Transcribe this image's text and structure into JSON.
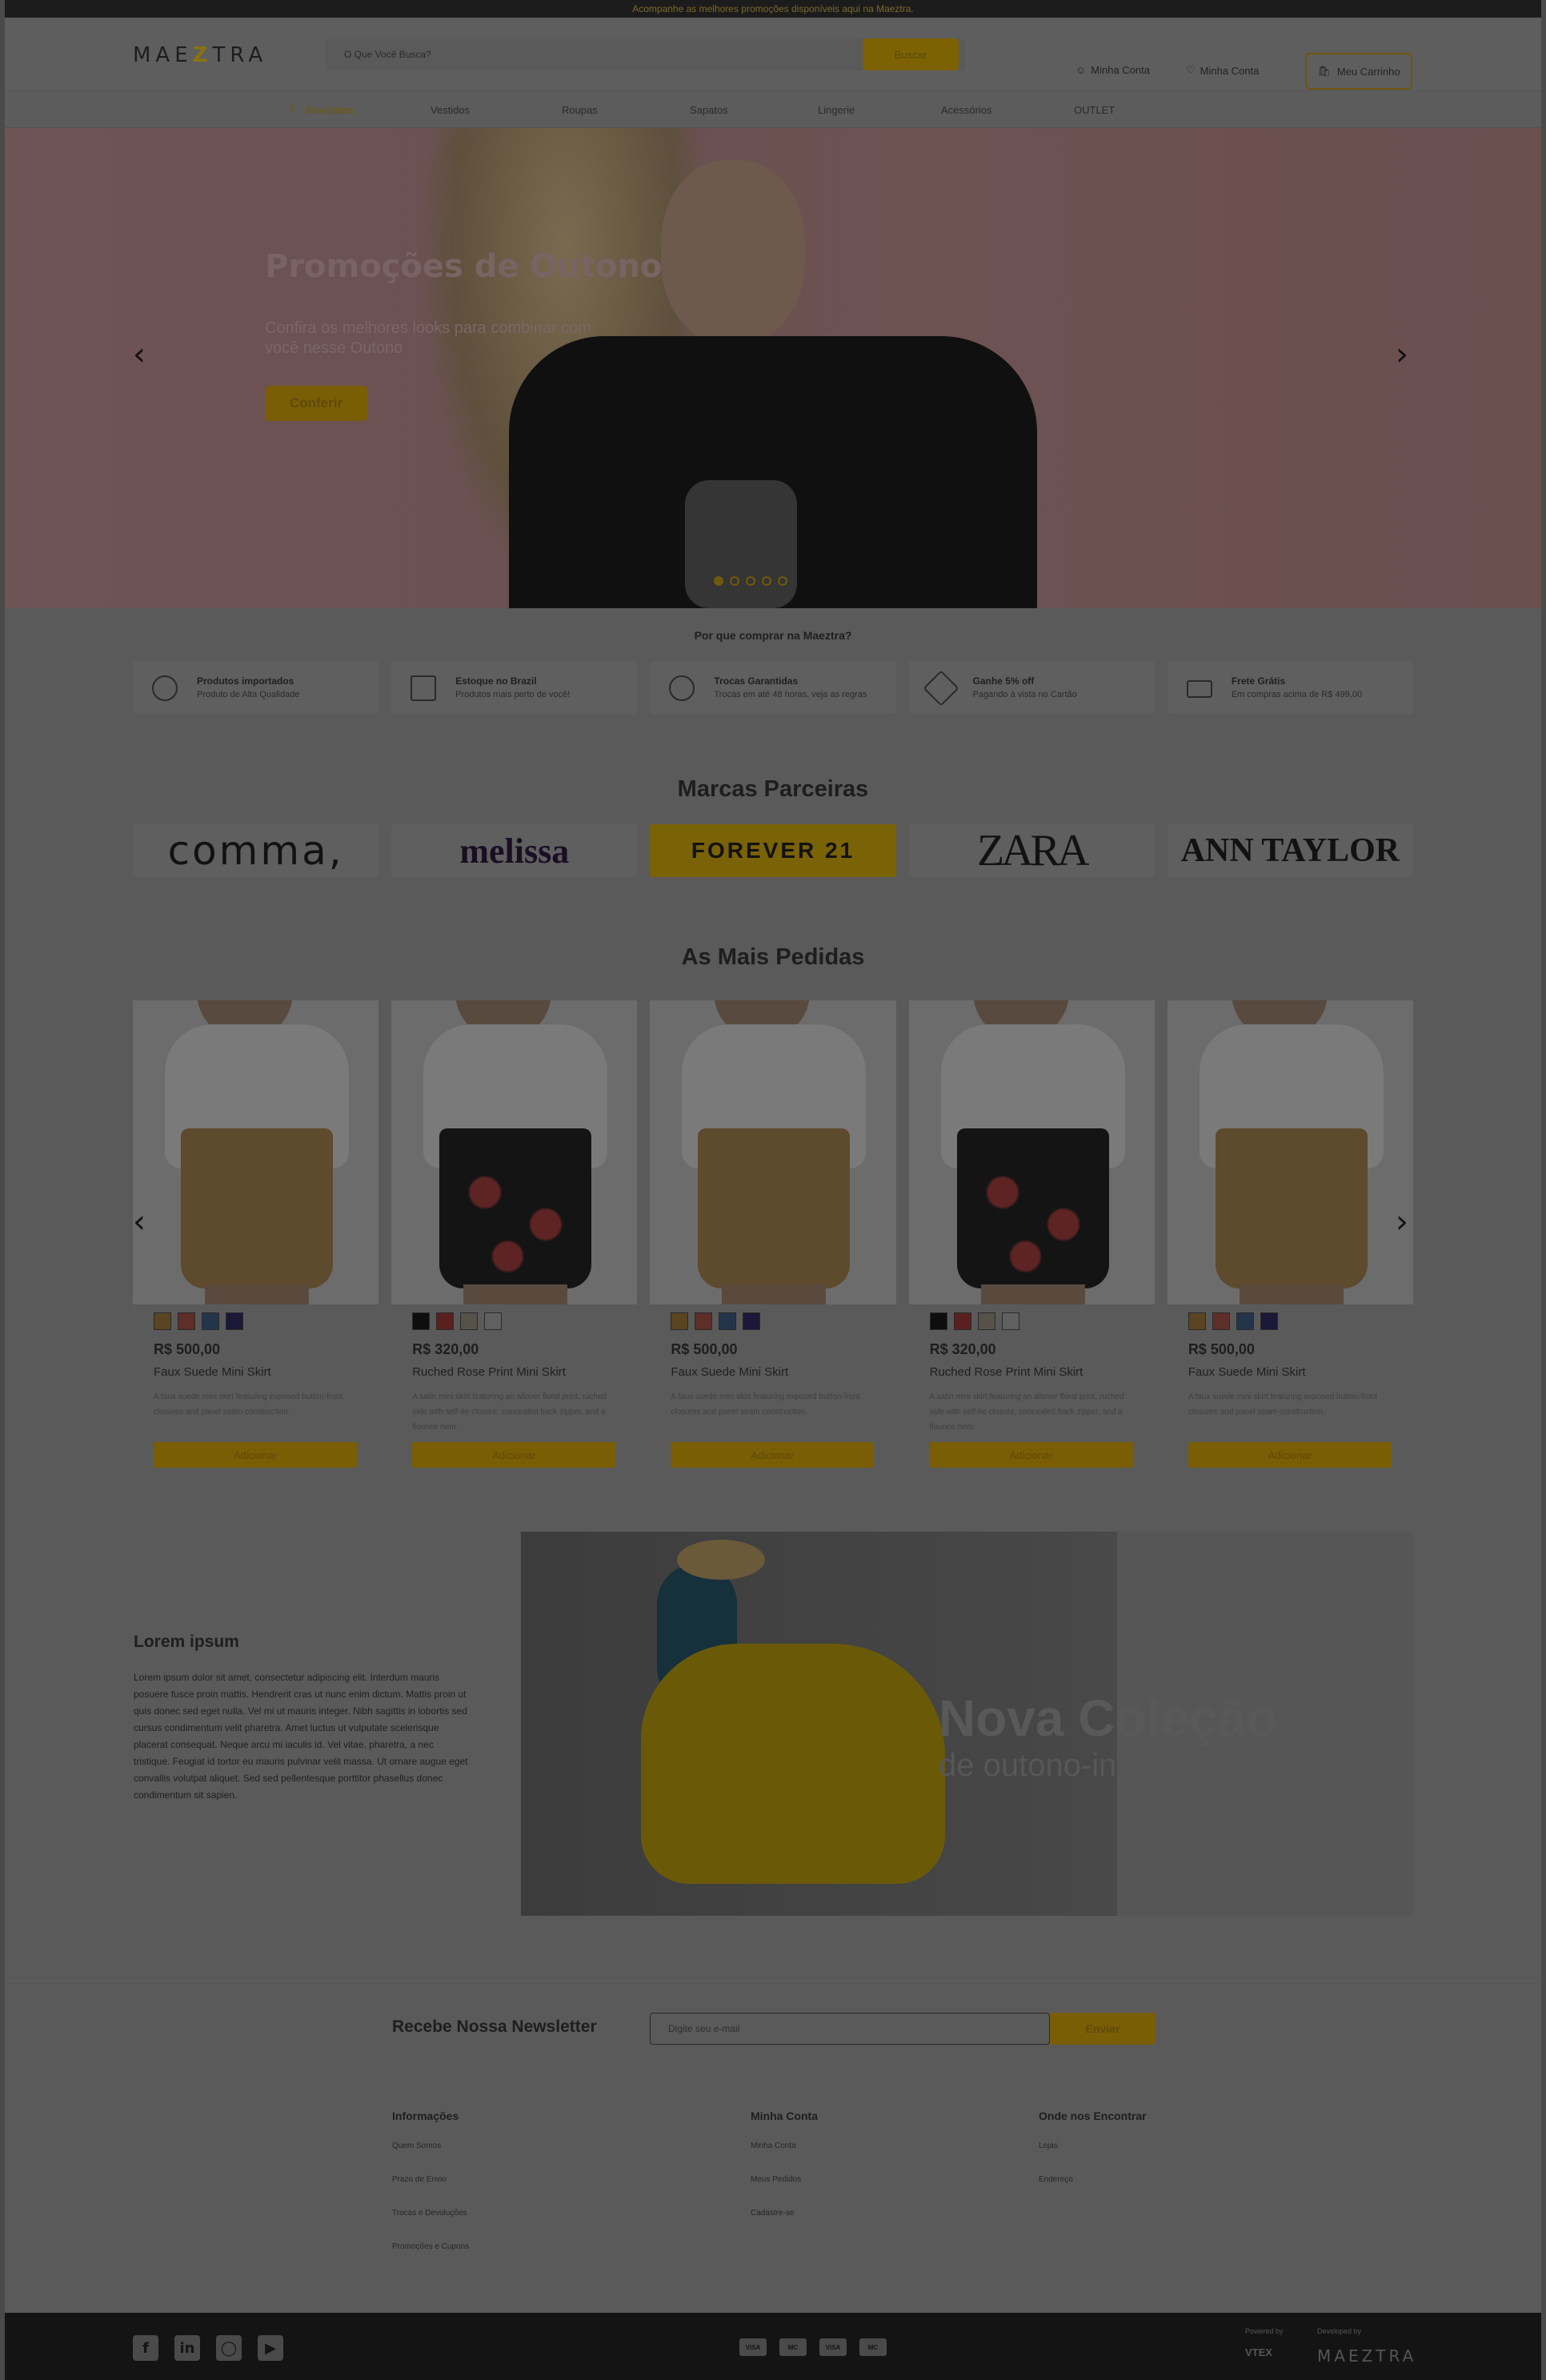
{
  "topbar": {
    "text": "Acompanhe as melhores promoções disponíveis aqui na Maeztra."
  },
  "header": {
    "logo": "MAEZTRA",
    "search_placeholder": "O Que Você Busca?",
    "search_button": "Buscar",
    "account_label": "Minha Conta",
    "wishlist_label": "Minha Conta",
    "cart_label": "Meu Carrinho"
  },
  "nav": [
    "Novidades",
    "Vestidos",
    "Roupas",
    "Sapatos",
    "Lingerie",
    "Acessórios",
    "OUTLET"
  ],
  "hero": {
    "title": "Promoções de Outono",
    "subtitle": "Confira os melhores looks para combinar com você nesse Outono",
    "cta": "Conferir",
    "slides": 5,
    "active_slide": 1
  },
  "why": {
    "title": "Por que comprar na Maeztra?",
    "items": [
      {
        "title": "Produtos importados",
        "subtitle": "Produto de Alta Qualidade",
        "icon": "globe-icon"
      },
      {
        "title": "Estoque no Brazil",
        "subtitle": "Produtos mais perto de você!",
        "icon": "warehouse-icon"
      },
      {
        "title": "Trocas Garantidas",
        "subtitle": "Trocas em até 48 horas, veja as regras",
        "icon": "exchange-icon"
      },
      {
        "title": "Ganhe 5% off",
        "subtitle": "Pagando à vista no Cartão",
        "icon": "tag-icon"
      },
      {
        "title": "Frete Grátis",
        "subtitle": "Em compras acima de R$ 499,00",
        "icon": "truck-icon"
      }
    ]
  },
  "brands": {
    "title": "Marcas Parceiras",
    "items": [
      "comma,",
      "melissa",
      "FOREVER 21",
      "ZARA",
      "ANN TAYLOR"
    ]
  },
  "best_sellers": {
    "title": "As Mais Pedidas",
    "products": [
      {
        "price": "R$ 500,00",
        "name": "Faux Suede Mini Skirt",
        "description": "A faux suede mini skirt featuring exposed button-front closures and panel seam construction.",
        "add": "Adicionar",
        "skirt": "tan",
        "colors": [
          "#5a4422",
          "#5e2e28",
          "#24344a",
          "#1c1838"
        ]
      },
      {
        "price": "R$ 320,00",
        "name": "Ruched Rose Print Mini Skirt",
        "description": "A satin mini skirt featuring an allover floral print, ruched side with self-tie closure, concealed back zipper, and a flounce hem.",
        "add": "Adicionar",
        "skirt": "floral",
        "colors": [
          "#0e0e0e",
          "#5a2020",
          "#56524a",
          "#606060"
        ]
      },
      {
        "price": "R$ 500,00",
        "name": "Faux Suede Mini Skirt",
        "description": "A faux suede mini skirt featuring exposed button-front closures and panel seam construction.",
        "add": "Adicionar",
        "skirt": "tan",
        "colors": [
          "#5a4422",
          "#5e2e28",
          "#24344a",
          "#1c1838"
        ]
      },
      {
        "price": "R$ 320,00",
        "name": "Ruched Rose Print Mini Skirt",
        "description": "A satin mini skirt featuring an allover floral print, ruched side with self-tie closure, concealed back zipper, and a flounce hem.",
        "add": "Adicionar",
        "skirt": "floral",
        "colors": [
          "#0e0e0e",
          "#5a2020",
          "#56524a",
          "#606060"
        ]
      },
      {
        "price": "R$ 500,00",
        "name": "Faux Suede Mini Skirt",
        "description": "A faux suede mini skirt featuring exposed button-front closures and panel seam construction.",
        "add": "Adicionar",
        "skirt": "tan",
        "colors": [
          "#5a4422",
          "#5e2e28",
          "#24344a",
          "#1c1838"
        ]
      }
    ]
  },
  "about": {
    "title": "Lorem ipsum",
    "text": "Lorem ipsum dolor sit amet, consectetur adipiscing elit. Interdum mauris posuere fusce proin mattis. Hendrerit cras ut nunc enim dictum. Mattis proin ut quis donec sed eget nulla. Vel mi ut mauris integer. Nibh sagittis in lobortis sed cursus condimentum velit pharetra. Amet luctus ut vulputate scelerisque placerat consequat. Neque arcu mi iaculis id. Vel vitae, pharetra, a nec tristique. Feugiat id tortor eu mauris pulvinar velit massa. Ut ornare augue eget convallis volutpat aliquet. Sed sed pellentesque porttitor phasellus donec condimentum sit sapien."
  },
  "collection": {
    "title": "Nova Coleção",
    "subtitle": "de outono-inverno"
  },
  "newsletter": {
    "title": "Recebe Nossa Newsletter",
    "placeholder": "Digite seu e-mail",
    "button": "Enviar"
  },
  "footer": {
    "columns": [
      {
        "title": "Informações",
        "links": [
          "Quem Somos",
          "Prazo de Envio",
          "Trocas e Devoluções",
          "Promoções e Cupons"
        ]
      },
      {
        "title": "Minha Conta",
        "links": [
          "Minha Conta",
          "Meus Pedidos",
          "Cadastre-se"
        ]
      },
      {
        "title": "Onde nos Encontrar",
        "links": [
          "Lojas",
          "Endereço"
        ]
      }
    ],
    "social": [
      "facebook-icon",
      "linkedin-icon",
      "instagram-icon",
      "youtube-icon"
    ],
    "payments": [
      "VISA",
      "MC",
      "VISA",
      "MC"
    ],
    "powered_by": "Powered by",
    "powered_name": "VTEX",
    "developed_by": "Developed by",
    "developed_name": "MAEZTRA"
  },
  "colors": {
    "accent": "#e0ac00",
    "overlay": "rgba(0,0,0,0.6)"
  }
}
